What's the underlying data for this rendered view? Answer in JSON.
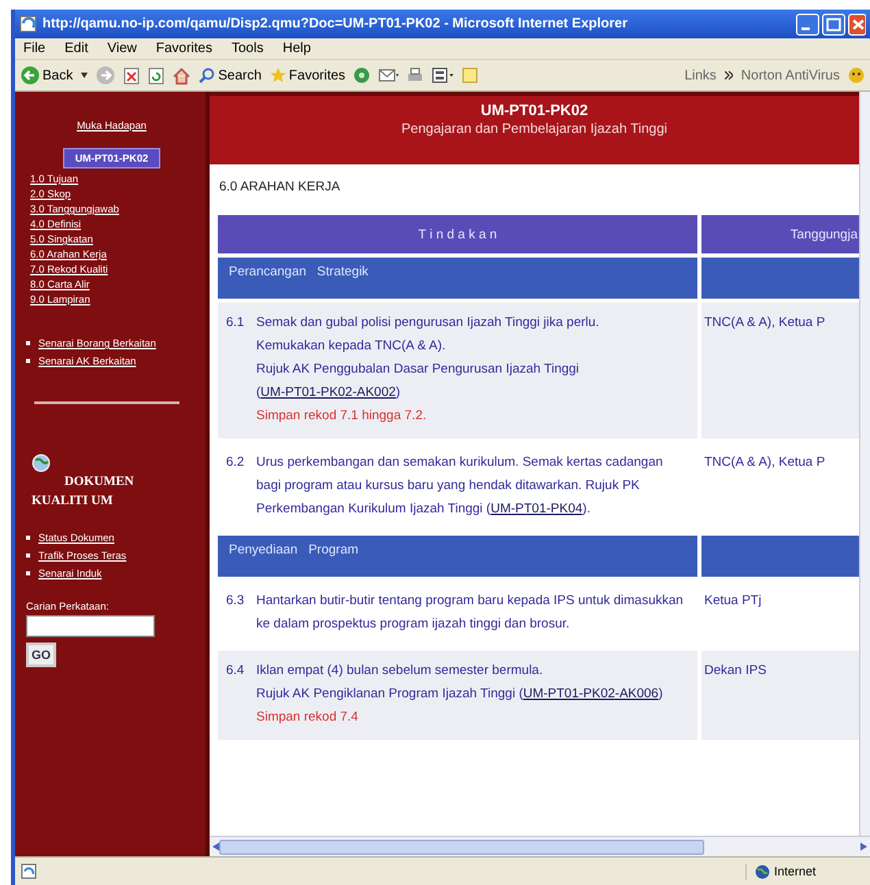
{
  "window": {
    "title": "http://qamu.no-ip.com/qamu/Disp2.qmu?Doc=UM-PT01-PK02 - Microsoft Internet Explorer"
  },
  "menu": [
    "File",
    "Edit",
    "View",
    "Favorites",
    "Tools",
    "Help"
  ],
  "toolbar": {
    "back": "Back",
    "search": "Search",
    "favorites": "Favorites",
    "links": "Links",
    "addon": "Norton AntiVirus"
  },
  "sidebar": {
    "home": "Muka Hadapan",
    "current": "UM-PT01-PK02",
    "sections": [
      {
        "number": "1.0",
        "label": "Tujuan"
      },
      {
        "number": "2.0",
        "label": "Skop"
      },
      {
        "number": "3.0",
        "label": "Tanggungjawab"
      },
      {
        "number": "4.0",
        "label": "Definisi"
      },
      {
        "number": "5.0",
        "label": "Singkatan"
      },
      {
        "number": "6.0",
        "label": "Arahan Kerja"
      },
      {
        "number": "7.0",
        "label": "Rekod Kualiti"
      },
      {
        "number": "8.0",
        "label": "Carta Alir"
      },
      {
        "number": "9.0",
        "label": "Lampiran"
      }
    ],
    "related": [
      "Senarai Borang Berkaitan",
      "Senarai AK Berkaitan"
    ],
    "quality_title": "DOKUMEN KUALITI UM",
    "quality_links": [
      "Status Dokumen",
      "Trafik Proses Teras",
      "Senarai Induk"
    ],
    "search_label": "Carian Perkataan:",
    "search_button": "GO"
  },
  "header": {
    "code": "UM-PT01-PK02",
    "title": "Pengajaran dan Pembelajaran Ijazah Tinggi"
  },
  "section_title": "6.0 ARAHAN KERJA",
  "table": {
    "columns": [
      "T i n d a k a n",
      "Tanggungja"
    ],
    "rows": [
      {
        "kind": "group",
        "label": "Perancangan   Strategik"
      },
      {
        "kind": "step",
        "number": "6.1",
        "shaded": true,
        "responsible": "TNC(A & A), Ketua P",
        "lines": [
          {
            "kind": "text",
            "segments": [
              {
                "kind": "text",
                "text": "Semak dan gubal polisi pengurusan Ijazah Tinggi jika perlu."
              }
            ]
          },
          {
            "kind": "text",
            "segments": [
              {
                "kind": "text",
                "text": "Kemukakan kepada TNC(A & A)."
              }
            ]
          },
          {
            "kind": "text",
            "segments": [
              {
                "kind": "text",
                "text": "Rujuk AK Penggubalan Dasar Pengurusan Ijazah Tinggi ("
              },
              {
                "kind": "link",
                "text": "UM-PT01-PK02-AK002"
              },
              {
                "kind": "text",
                "text": ")"
              }
            ]
          },
          {
            "kind": "note",
            "segments": [
              {
                "kind": "text",
                "text": "Simpan rekod 7.1 hingga 7.2."
              }
            ]
          }
        ]
      },
      {
        "kind": "step",
        "number": "6.2",
        "shaded": false,
        "responsible": "TNC(A & A), Ketua P",
        "lines": [
          {
            "kind": "text",
            "segments": [
              {
                "kind": "text",
                "text": "Urus perkembangan dan semakan kurikulum. Semak kertas cadangan bagi program atau kursus baru yang hendak ditawarkan. Rujuk PK Perkembangan Kurikulum Ijazah Tinggi ("
              },
              {
                "kind": "link",
                "text": "UM-PT01-PK04"
              },
              {
                "kind": "text",
                "text": ")."
              }
            ]
          }
        ]
      },
      {
        "kind": "group",
        "label": "Penyediaan   Program"
      },
      {
        "kind": "step",
        "number": "6.3",
        "shaded": false,
        "responsible": "Ketua PTj",
        "lines": [
          {
            "kind": "text",
            "segments": [
              {
                "kind": "text",
                "text": "Hantarkan butir-butir tentang program baru kepada IPS untuk dimasukkan ke dalam prospektus program ijazah tinggi dan brosur."
              }
            ]
          }
        ]
      },
      {
        "kind": "step",
        "number": "6.4",
        "shaded": true,
        "responsible": "Dekan IPS",
        "lines": [
          {
            "kind": "text",
            "segments": [
              {
                "kind": "text",
                "text": "Iklan empat (4) bulan sebelum semester bermula."
              }
            ]
          },
          {
            "kind": "text",
            "segments": [
              {
                "kind": "text",
                "text": "Rujuk AK Pengiklanan Program Ijazah Tinggi ("
              },
              {
                "kind": "link",
                "text": "UM-PT01-PK02-AK006"
              },
              {
                "kind": "text",
                "text": ")"
              }
            ]
          },
          {
            "kind": "note",
            "segments": [
              {
                "kind": "text",
                "text": "Simpan rekod 7.4"
              }
            ]
          }
        ]
      }
    ]
  },
  "status_bar": {
    "zone": "Internet"
  }
}
